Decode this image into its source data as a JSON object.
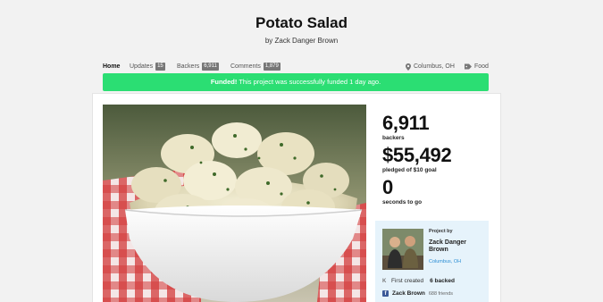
{
  "project": {
    "title": "Potato Salad",
    "byline": "by Zack Danger Brown"
  },
  "nav": {
    "home": "Home",
    "updates": "Updates",
    "updates_count": "15",
    "backers": "Backers",
    "backers_count": "6,911",
    "comments": "Comments",
    "comments_count": "1,879",
    "location": "Columbus, OH",
    "category": "Food"
  },
  "banner": {
    "strong": "Funded!",
    "text": " This project was successfully funded 1 day ago."
  },
  "stats": {
    "backers_value": "6,911",
    "backers_label": "backers",
    "pledged_value": "$55,492",
    "pledged_label": "pledged of $10 goal",
    "time_value": "0",
    "time_label": "seconds to go"
  },
  "creator": {
    "project_by": "Project by",
    "name": "Zack Danger Brown",
    "location": "Columbus, OH",
    "first_created": "First created",
    "backed": "6 backed",
    "fb_name": "Zack Brown",
    "friends": "688 friends"
  },
  "colors": {
    "accent_green": "#2bde73",
    "creator_bg": "#e6f3fb",
    "link_blue": "#2a8dd4"
  }
}
